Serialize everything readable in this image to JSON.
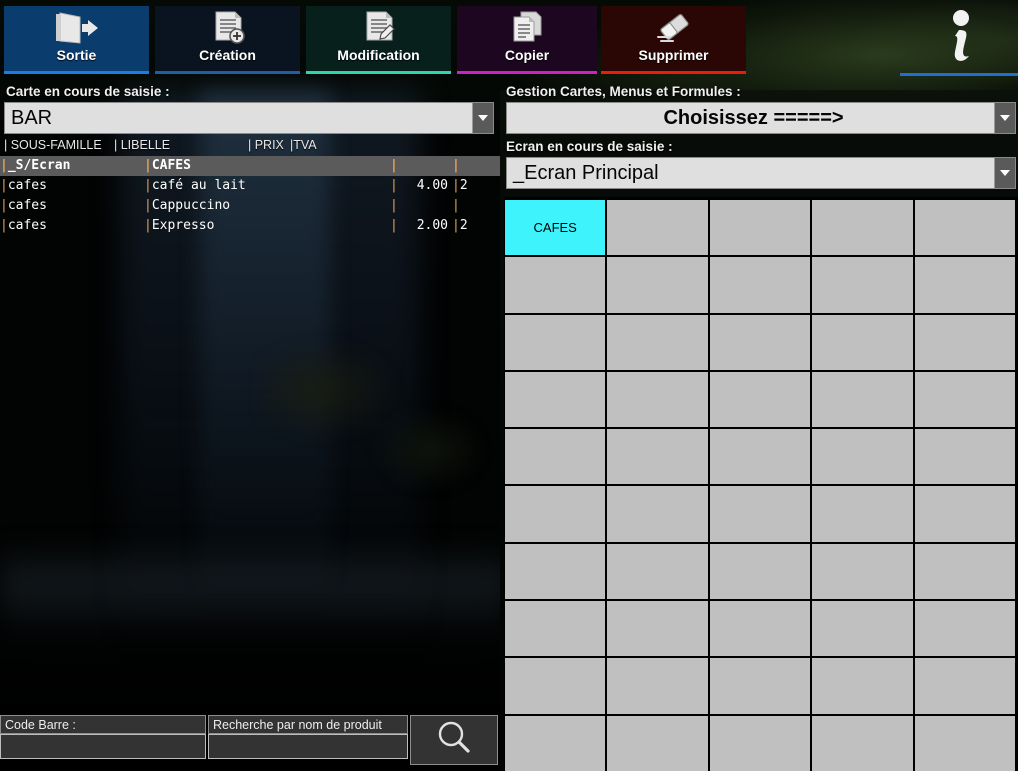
{
  "toolbar": {
    "buttons": [
      {
        "id": "sortie",
        "label": "Sortie",
        "icon": "exit-door-icon",
        "bg": "#0b3c6e",
        "underline": "#1a7fe0"
      },
      {
        "id": "creation",
        "label": "Création",
        "icon": "document-add-icon",
        "bg": "#0a1420",
        "underline": "#1f5fa8"
      },
      {
        "id": "modification",
        "label": "Modification",
        "icon": "document-edit-icon",
        "bg": "#07201c",
        "underline": "#2fd6ad"
      },
      {
        "id": "copier",
        "label": "Copier",
        "icon": "document-copy-icon",
        "bg": "#1d0620",
        "underline": "#cc22c4"
      },
      {
        "id": "supprimer",
        "label": "Supprimer",
        "icon": "eraser-icon",
        "bg": "#2a0705",
        "underline": "#e61f06"
      }
    ],
    "info": {
      "label": "i",
      "icon": "info-icon",
      "underline": "#1f6fd0"
    }
  },
  "left": {
    "card_label": "Carte en cours de saisie :",
    "card_value": "BAR",
    "columns": [
      "| SOUS-FAMILLE",
      "| LIBELLE",
      "| PRIX",
      "|TVA"
    ],
    "rows": [
      {
        "sous_famille": "_S/Ecran",
        "libelle": "CAFES",
        "prix": "",
        "tva": "",
        "selected": true
      },
      {
        "sous_famille": "cafes",
        "libelle": "café au lait",
        "prix": "4.00",
        "tva": "2",
        "selected": false
      },
      {
        "sous_famille": "cafes",
        "libelle": "Cappuccino",
        "prix": "",
        "tva": "",
        "selected": false
      },
      {
        "sous_famille": "cafes",
        "libelle": "Expresso",
        "prix": "2.00",
        "tva": "2",
        "selected": false
      }
    ],
    "search": {
      "barcode_label": "Code Barre :",
      "barcode_value": "",
      "name_label": "Recherche par nom de produit",
      "name_value": "",
      "button_icon": "search-magnifier-icon"
    }
  },
  "right": {
    "gestion_label": "Gestion Cartes, Menus et Formules  :",
    "gestion_value": "Choisissez  =====>",
    "ecran_label": "Ecran en cours de saisie :",
    "ecran_value": "_Ecran Principal",
    "grid": {
      "columns": 5,
      "rows": 10,
      "active_color": "#3ef3fb",
      "empty_color": "#c0c0c0",
      "cells": [
        "CAFES",
        "",
        "",
        "",
        "",
        "",
        "",
        "",
        "",
        "",
        "",
        "",
        "",
        "",
        "",
        "",
        "",
        "",
        "",
        "",
        "",
        "",
        "",
        "",
        "",
        "",
        "",
        "",
        "",
        "",
        "",
        "",
        "",
        "",
        "",
        "",
        "",
        "",
        "",
        "",
        "",
        "",
        "",
        "",
        "",
        "",
        "",
        "",
        "",
        ""
      ],
      "active_index": 0
    }
  }
}
